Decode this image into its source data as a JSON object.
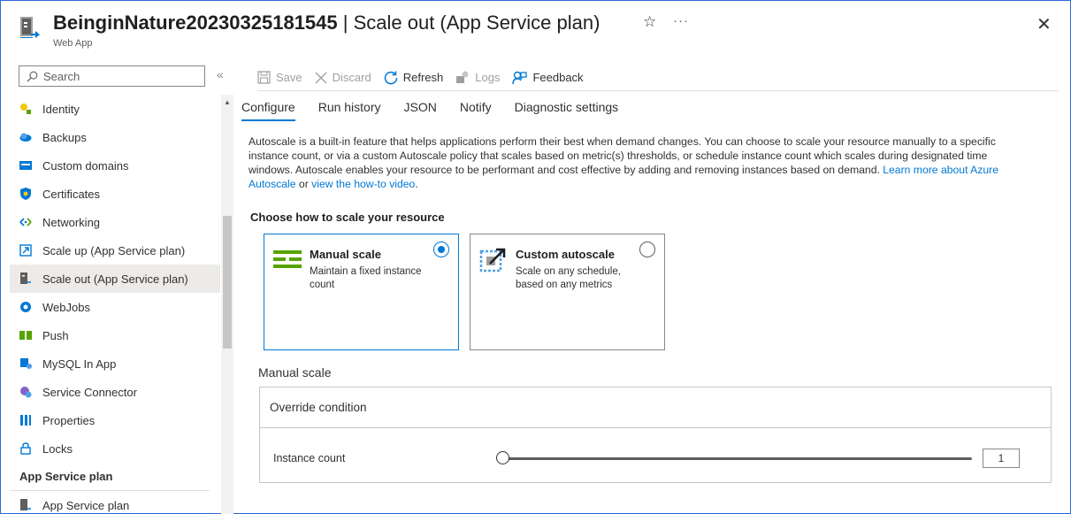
{
  "header": {
    "title_bold": "BeinginNature20230325181545",
    "title_rest": " | Scale out (App Service plan)",
    "subtitle": "Web App",
    "star": "☆",
    "more": "···",
    "close": "✕"
  },
  "sidebar": {
    "search_placeholder": "Search",
    "collapse": "«",
    "items": [
      {
        "label": "Identity",
        "icon": "identity-icon"
      },
      {
        "label": "Backups",
        "icon": "backups-icon"
      },
      {
        "label": "Custom domains",
        "icon": "custom-domains-icon"
      },
      {
        "label": "Certificates",
        "icon": "certificates-icon"
      },
      {
        "label": "Networking",
        "icon": "networking-icon"
      },
      {
        "label": "Scale up (App Service plan)",
        "icon": "scale-up-icon"
      },
      {
        "label": "Scale out (App Service plan)",
        "icon": "scale-out-icon",
        "active": true
      },
      {
        "label": "WebJobs",
        "icon": "webjobs-icon"
      },
      {
        "label": "Push",
        "icon": "push-icon"
      },
      {
        "label": "MySQL In App",
        "icon": "mysql-icon"
      },
      {
        "label": "Service Connector",
        "icon": "service-connector-icon"
      },
      {
        "label": "Properties",
        "icon": "properties-icon"
      },
      {
        "label": "Locks",
        "icon": "lock-icon"
      }
    ],
    "section": "App Service plan",
    "section_items": [
      {
        "label": "App Service plan",
        "icon": "app-service-plan-icon"
      }
    ]
  },
  "toolbar": {
    "save": "Save",
    "discard": "Discard",
    "refresh": "Refresh",
    "logs": "Logs",
    "feedback": "Feedback"
  },
  "tabs": [
    "Configure",
    "Run history",
    "JSON",
    "Notify",
    "Diagnostic settings"
  ],
  "description": {
    "text": "Autoscale is a built-in feature that helps applications perform their best when demand changes. You can choose to scale your resource manually to a specific instance count, or via a custom Autoscale policy that scales based on metric(s) thresholds, or schedule instance count which scales during designated time windows. Autoscale enables your resource to be performant and cost effective by adding and removing instances based on demand. ",
    "link1": "Learn more about Azure Autoscale",
    "or": " or ",
    "link2": "view the how-to video",
    "end": "."
  },
  "choose_title": "Choose how to scale your resource",
  "options": {
    "manual": {
      "title": "Manual scale",
      "desc": "Maintain a fixed instance count",
      "selected": true
    },
    "custom": {
      "title": "Custom autoscale",
      "desc": "Scale on any schedule, based on any metrics",
      "selected": false
    }
  },
  "manual_section": {
    "label": "Manual scale",
    "override": "Override condition",
    "instance_label": "Instance count",
    "instance_value": "1"
  },
  "colors": {
    "accent": "#0078d4",
    "green": "#57a300"
  }
}
